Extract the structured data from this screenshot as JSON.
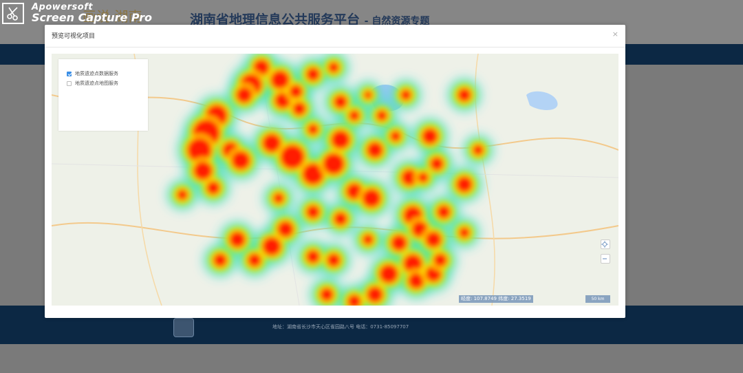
{
  "watermark": {
    "brand": "Apowersoft",
    "product": "Screen Capture Pro"
  },
  "header": {
    "logo_text": "画说·湖南",
    "title": "湖南省地理信息公共服务平台",
    "subtitle": "- 自然资源专题"
  },
  "footer": {
    "address": "地址：湖南省长沙市天心区雀园路八号  电话：0731-85097707"
  },
  "modal": {
    "title": "预览可视化项目",
    "close_icon": "×",
    "layers": [
      {
        "label": "地质遗迹点数据服务",
        "checked": true
      },
      {
        "label": "地质遗迹点地图服务",
        "checked": false
      }
    ],
    "zoom_in_icon": "locate-icon",
    "zoom_out_icon": "minus-icon",
    "coordinates": "经度: 107.8749 纬度: 27.3519",
    "scale": "50 km"
  },
  "colors": {
    "navbar": "#0c2844",
    "heat_low": "#2bd6e8",
    "heat_mid": "#7ef03c",
    "heat_high": "#ffe000",
    "heat_peak": "#ff1a00",
    "checkbox": "#3a8ee6"
  }
}
